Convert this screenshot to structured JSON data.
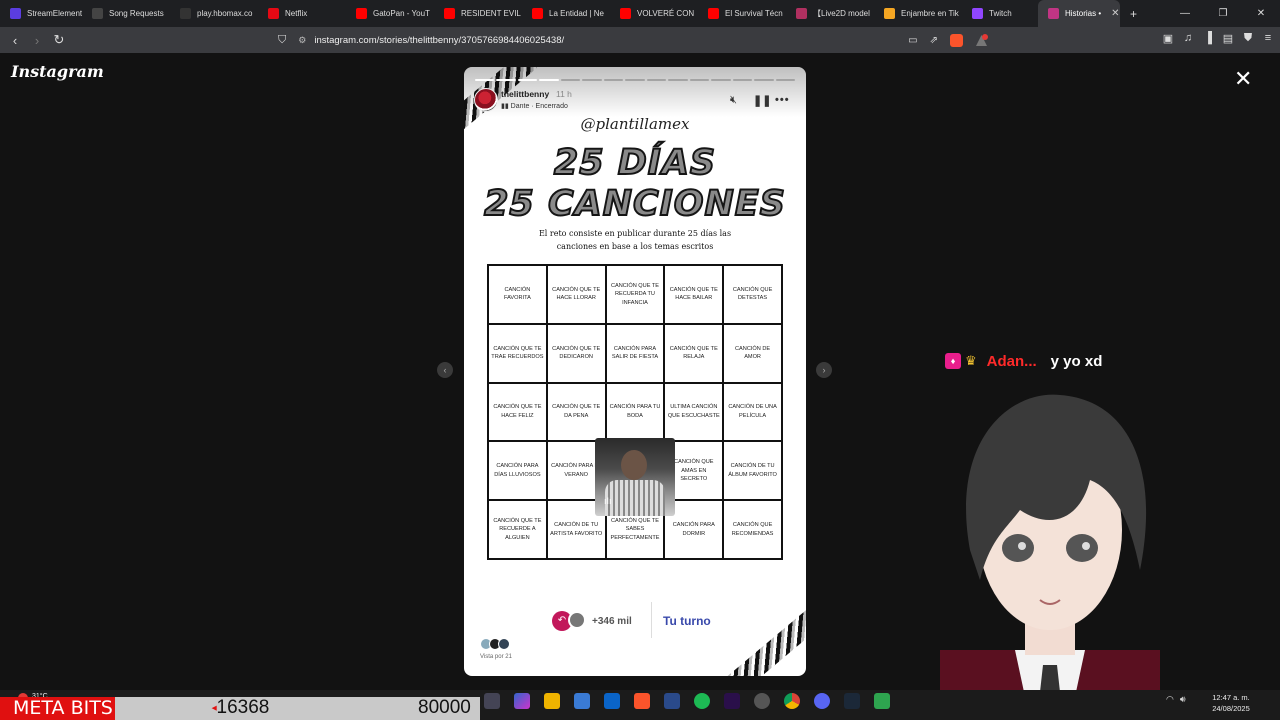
{
  "browser": {
    "tabs": [
      {
        "title": "StreamElement",
        "color": "#5b3de0"
      },
      {
        "title": "Song Requests",
        "color": "#444"
      },
      {
        "title": "play.hbomax.co",
        "color": "#333"
      },
      {
        "title": "Netflix",
        "color": "#e50914"
      },
      {
        "title": "GatoPan - YouT",
        "color": "#ff0000"
      },
      {
        "title": "RESIDENT EVIL",
        "color": "#ff0000"
      },
      {
        "title": "La Entidad | Ne",
        "color": "#ff0000"
      },
      {
        "title": "VOLVERÉ CON",
        "color": "#ff0000"
      },
      {
        "title": "El Survival Técn",
        "color": "#ff0000"
      },
      {
        "title": "【Live2D model",
        "color": "#b03060"
      },
      {
        "title": "Enjambre en Tik",
        "color": "#f5a623"
      },
      {
        "title": "Twitch",
        "color": "#9146ff"
      },
      {
        "title": "Historias •",
        "color": "#c13584",
        "active": true
      }
    ],
    "new_tab": "+",
    "win_min": "—",
    "win_max": "❐",
    "win_close": "✕",
    "url": "instagram.com/stories/thelittbenny/3705766984406025438/"
  },
  "instagram": {
    "logo": "Instagram",
    "close": "✕",
    "prev": "‹",
    "next": "›"
  },
  "story": {
    "segments": 15,
    "segments_done": 4,
    "username": "thelittbenny",
    "time": "11 h",
    "music": "Dante · Encerrado",
    "handle": "@plantillamex",
    "title_line1": "25 DÍAS",
    "title_line2": "25 CANCIONES",
    "description": "El reto consiste en publicar durante 25 días las canciones en base a los temas escritos",
    "grid": [
      "Canción favorita",
      "Canción que te hace llorar",
      "Canción que te recuerda tu infancia",
      "Canción que te hace bailar",
      "Canción que detestas",
      "Canción que te trae recuerdos",
      "Canción que te dedicaron",
      "Canción para salir de fiesta",
      "Canción que te relaja",
      "Canción de amor",
      "Canción que te hace feliz",
      "Canción que te da pena",
      "Canción para tu boda",
      "Ultima canción que escuchaste",
      "Canción de una película",
      "Canción para días lluviosos",
      "Canción para el verano",
      "",
      "Canción que amas en secreto",
      "Canción de tu álbum favorito",
      "Canción que te recuerde a alguien",
      "Canción de tu artista favorito",
      "Canción que te sabes perfectamente",
      "Canción para dormir",
      "Canción que recomiendas"
    ],
    "likes": "+346 mil",
    "your_turn": "Tu turno",
    "viewed_by": "Vista por 21"
  },
  "chat": {
    "name": "Adan...",
    "message": "y yo xd"
  },
  "overlay": {
    "label": "META BITS",
    "current": "16368",
    "goal": "80000",
    "progress_fraction": 0.2
  },
  "taskbar": {
    "weather_temp": "31°C",
    "time": "12:47 a. m.",
    "date": "24/08/2025"
  }
}
